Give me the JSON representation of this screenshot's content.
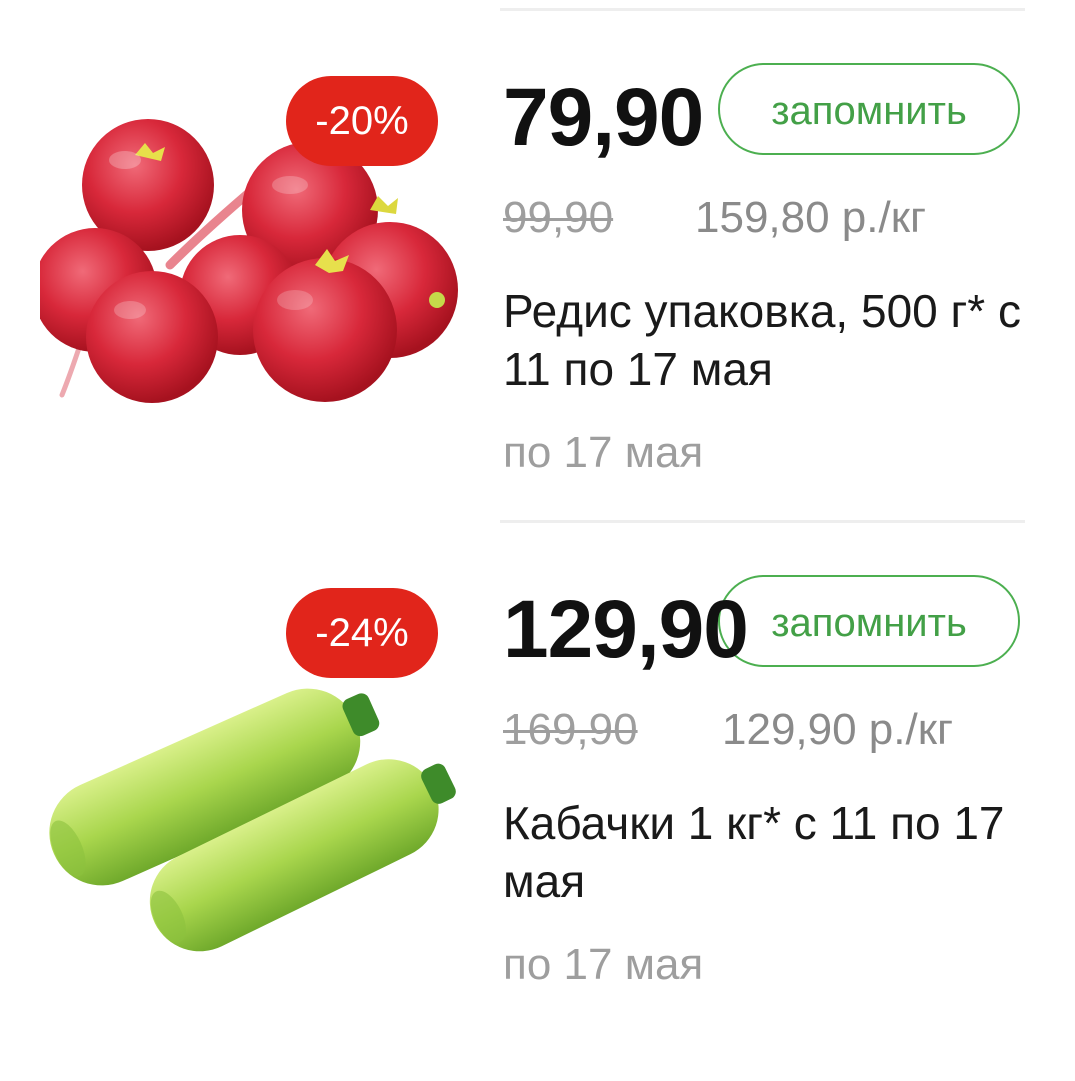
{
  "products": [
    {
      "image": "radish-bunch-image",
      "discount": "-20%",
      "price": "79,90",
      "remember_label": "запомнить",
      "old_price": "99,90",
      "unit_price": "159,80 р./кг",
      "title": "Редис упаковка, 500 г* с 11 по 17 мая",
      "valid_until": "по 17 мая"
    },
    {
      "image": "zucchini-pair-image",
      "discount": "-24%",
      "price": "129,90",
      "remember_label": "запомнить",
      "old_price": "169,90",
      "unit_price": "129,90 р./кг",
      "title": "Кабачки 1 кг* с 11 по 17 мая",
      "valid_until": "по 17 мая"
    }
  ],
  "colors": {
    "badge": "#e1251b",
    "button_border": "#4caf50",
    "button_text": "#43a047",
    "price": "#111111",
    "muted": "#9e9e9e",
    "divider": "#eeeeee"
  }
}
